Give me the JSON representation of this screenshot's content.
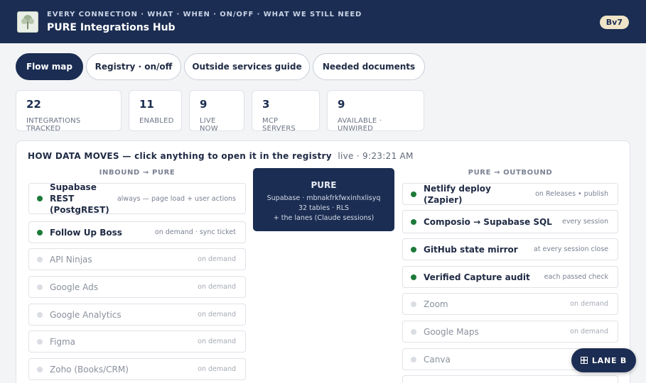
{
  "header": {
    "eyebrow": "EVERY CONNECTION · WHAT · WHEN · ON/OFF · WHAT WE STILL NEED",
    "title": "PURE Integrations Hub",
    "version": "Bv7"
  },
  "tabs": [
    {
      "label": "Flow map",
      "active": true
    },
    {
      "label": "Registry · on/off",
      "active": false
    },
    {
      "label": "Outside services guide",
      "active": false
    },
    {
      "label": "Needed documents",
      "active": false
    }
  ],
  "stats": [
    {
      "value": "22",
      "label": "INTEGRATIONS TRACKED"
    },
    {
      "value": "11",
      "label": "ENABLED"
    },
    {
      "value": "9",
      "label": "LIVE NOW"
    },
    {
      "value": "3",
      "label": "MCP SERVERS"
    },
    {
      "value": "9",
      "label": "AVAILABLE · UNWIRED"
    }
  ],
  "flow": {
    "heading": "HOW DATA MOVES — click anything to open it in the registry",
    "live_label": "live · 9:23:21 AM",
    "inbound_title": "INBOUND → PURE",
    "outbound_title": "PURE → OUTBOUND",
    "center": {
      "title": "PURE",
      "line1": "Supabase · mbnakfrkfwxinhxlisyq",
      "line2": "32 tables · RLS",
      "line3": "+ the lanes (Claude sessions)"
    },
    "inbound": [
      {
        "name": "Supabase REST (PostgREST)",
        "note": "always — page load + user actions",
        "status": "on"
      },
      {
        "name": "Follow Up Boss",
        "note": "on demand · sync ticket",
        "status": "on"
      },
      {
        "name": "API Ninjas",
        "note": "on demand",
        "status": "off"
      },
      {
        "name": "Google Ads",
        "note": "on demand",
        "status": "off"
      },
      {
        "name": "Google Analytics",
        "note": "on demand",
        "status": "off"
      },
      {
        "name": "Figma",
        "note": "on demand",
        "status": "off"
      },
      {
        "name": "Zoho (Books/CRM)",
        "note": "on demand",
        "status": "off"
      }
    ],
    "outbound": [
      {
        "name": "Netlify deploy (Zapier)",
        "note": "on Releases • publish",
        "status": "on"
      },
      {
        "name": "Composio → Supabase SQL",
        "note": "every session",
        "status": "on"
      },
      {
        "name": "GitHub state mirror",
        "note": "at every session close",
        "status": "on"
      },
      {
        "name": "Verified Capture audit",
        "note": "each passed check",
        "status": "on"
      },
      {
        "name": "Zoom",
        "note": "on demand",
        "status": "off"
      },
      {
        "name": "Google Maps",
        "note": "on demand",
        "status": "off"
      },
      {
        "name": "Canva",
        "note": "",
        "status": "off"
      }
    ]
  },
  "lane_button": {
    "label": "LANE B",
    "icon": "grid-icon"
  },
  "colors": {
    "navy": "#1b2d52",
    "enabled_dot": "#1d7a3a",
    "disabled_dot": "#dadde2",
    "badge": "#efe4c8"
  }
}
